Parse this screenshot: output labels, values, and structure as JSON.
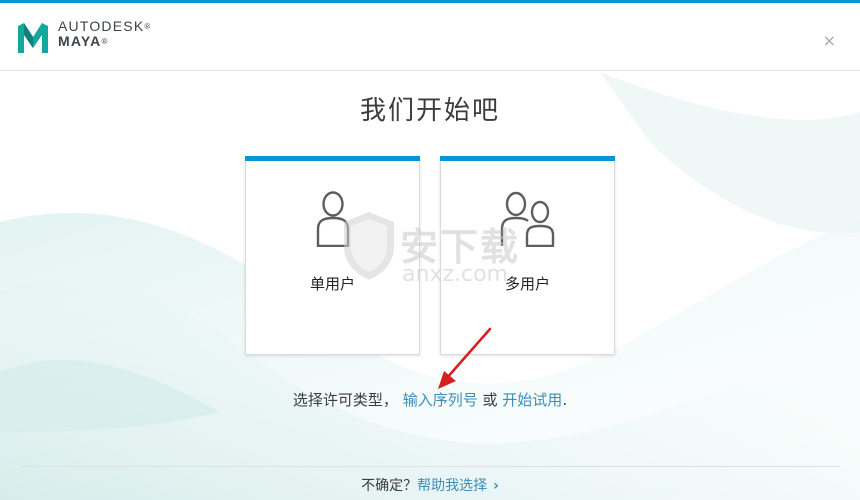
{
  "brand": {
    "line1": "AUTODESK",
    "trademark": "®",
    "line2": "MAYA",
    "trademark2": "®"
  },
  "window": {
    "close_glyph": "×"
  },
  "main": {
    "title": "我们开始吧"
  },
  "cards": [
    {
      "label": "单用户",
      "icon": "single-user-icon"
    },
    {
      "label": "多用户",
      "icon": "multi-user-icon"
    }
  ],
  "license": {
    "prompt": "选择许可类型，",
    "serial_link": "输入序列号",
    "or": "或",
    "trial_link": "开始试用",
    "end": "."
  },
  "footer": {
    "question": "不确定？",
    "help_link": "帮助我选择",
    "chevron": "›"
  },
  "watermark": {
    "cn": "安下载",
    "en": "anxz.com"
  },
  "colors": {
    "accent": "#0696d7",
    "link": "#3c8dbc",
    "annotation_arrow": "#d42020"
  }
}
